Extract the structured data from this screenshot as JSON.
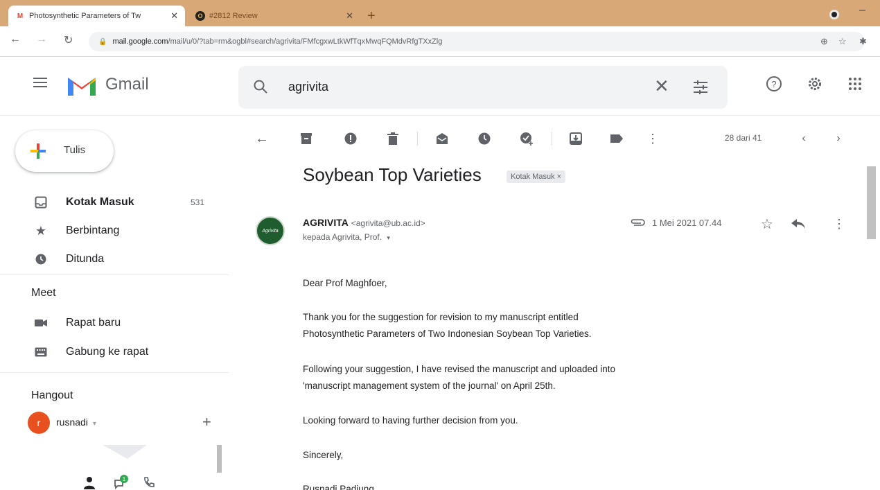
{
  "browser": {
    "tabs": [
      {
        "title": "Photosynthetic Parameters of Tw",
        "favicon": "gmail-icon",
        "active": true
      },
      {
        "title": "#2812 Review",
        "favicon": "ojs-icon",
        "active": false
      }
    ],
    "url_host": "mail.google.com",
    "url_path": "/mail/u/0/?tab=rm&ogbl#search/agrivita/FMfcgxwLtkWfTqxMwqFQMdvRfgTXxZlg"
  },
  "gmail": {
    "brand": "Gmail",
    "search_value": "agrivita",
    "compose_label": "Tulis",
    "nav": [
      {
        "label": "Kotak Masuk",
        "count": "531",
        "icon": "inbox-icon"
      },
      {
        "label": "Berbintang",
        "icon": "star-icon"
      },
      {
        "label": "Ditunda",
        "icon": "clock-icon"
      }
    ],
    "meet": {
      "heading": "Meet",
      "items": [
        {
          "label": "Rapat baru",
          "icon": "video-icon"
        },
        {
          "label": "Gabung ke rapat",
          "icon": "keyboard-icon"
        }
      ]
    },
    "hangout": {
      "heading": "Hangout",
      "user": "rusnadi",
      "user_initial": "r",
      "caret": "▾",
      "badge": "1"
    },
    "pager": "28 dari 41"
  },
  "message": {
    "subject": "Soybean Top Varieties",
    "label": "Kotak Masuk ×",
    "avatar_text": "Agrivita",
    "sender_name": "AGRIVITA",
    "sender_email": "<agrivita@ub.ac.id>",
    "to": "kepada Agrivita, Prof.",
    "date": "1 Mei 2021 07.44",
    "body": [
      "Dear Prof Maghfoer,",
      "Thank you for the suggestion for revision to my manuscript entitled",
      "Photosynthetic Parameters of Two Indonesian Soybean Top Varieties.",
      "Following your suggestion, I have revised the manuscript and uploaded into",
      "'manuscript management system of the journal' on April 25th.",
      "Looking forward  to having further decision from you.",
      "Sincerely,",
      "Rusnadi Padjung"
    ]
  },
  "colors": {
    "tabstrip": "#d9a877",
    "gmail_red": "#ea4335",
    "gmail_blue": "#4285f4",
    "gmail_green": "#34a853",
    "gmail_yellow": "#fbbc04"
  }
}
